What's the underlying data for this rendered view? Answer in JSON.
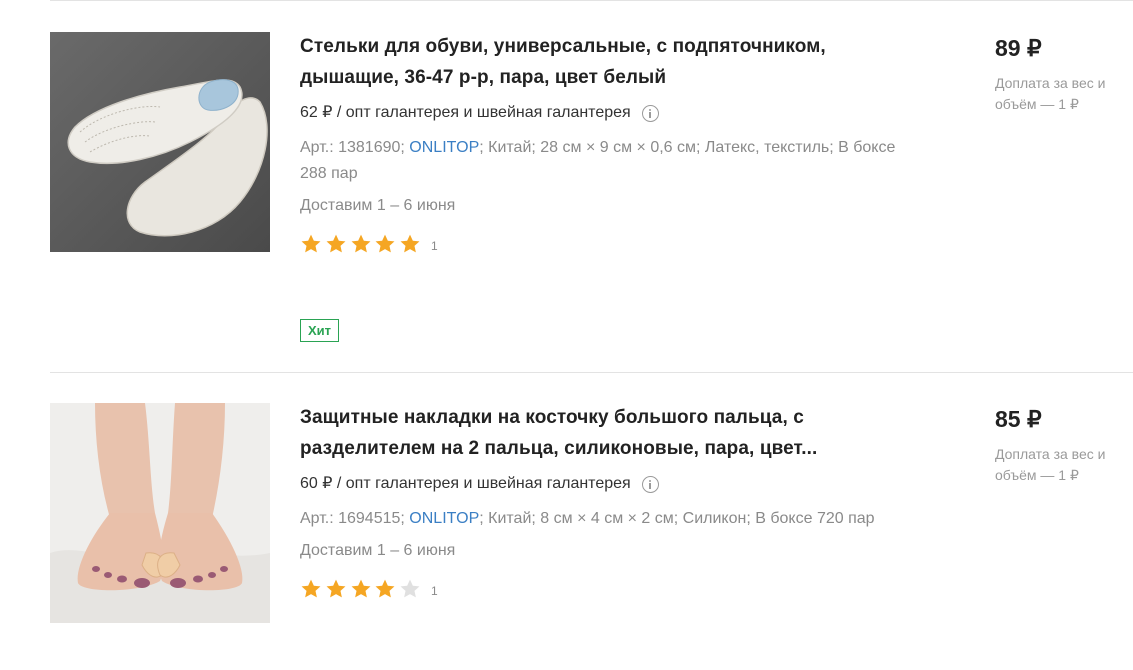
{
  "products": [
    {
      "title": "Стельки для обуви, универсальные, с подпяточником, дышащие, 36-47 р-р, пара, цвет белый",
      "wholesale": "62 ₽ / опт галантерея и швейная галантерея",
      "meta_pre": "Арт.: 1381690; ",
      "brand": "ONLITOP",
      "meta_post": "; Китай; 28 см × 9 см × 0,6 см; Латекс, текстиль; В боксе 288 пар",
      "delivery": "Доставим 1 – 6 июня",
      "rating": 5,
      "rating_count": "1",
      "badge": "Хит",
      "price": "89 ₽",
      "surcharge": "Доплата за вес и объём — 1 ₽"
    },
    {
      "title": "Защитные накладки на косточку большого пальца, с разделителем на 2 пальца, силиконовые, пара, цвет...",
      "wholesale": "60 ₽ / опт галантерея и швейная галантерея",
      "meta_pre": "Арт.: 1694515; ",
      "brand": "ONLITOP",
      "meta_post": "; Китай; 8 см × 4 см × 2 см; Силикон; В боксе 720 пар",
      "delivery": "Доставим 1 – 6 июня",
      "rating": 4,
      "rating_count": "1",
      "price": "85 ₽",
      "surcharge": "Доплата за вес и объём — 1 ₽"
    }
  ],
  "icons": {
    "info": "info-icon",
    "star": "star-icon"
  },
  "colors": {
    "star_filled": "#f5a623",
    "star_empty": "#e0e0e0",
    "brand_link": "#3b7fc4",
    "badge": "#2aa353"
  }
}
